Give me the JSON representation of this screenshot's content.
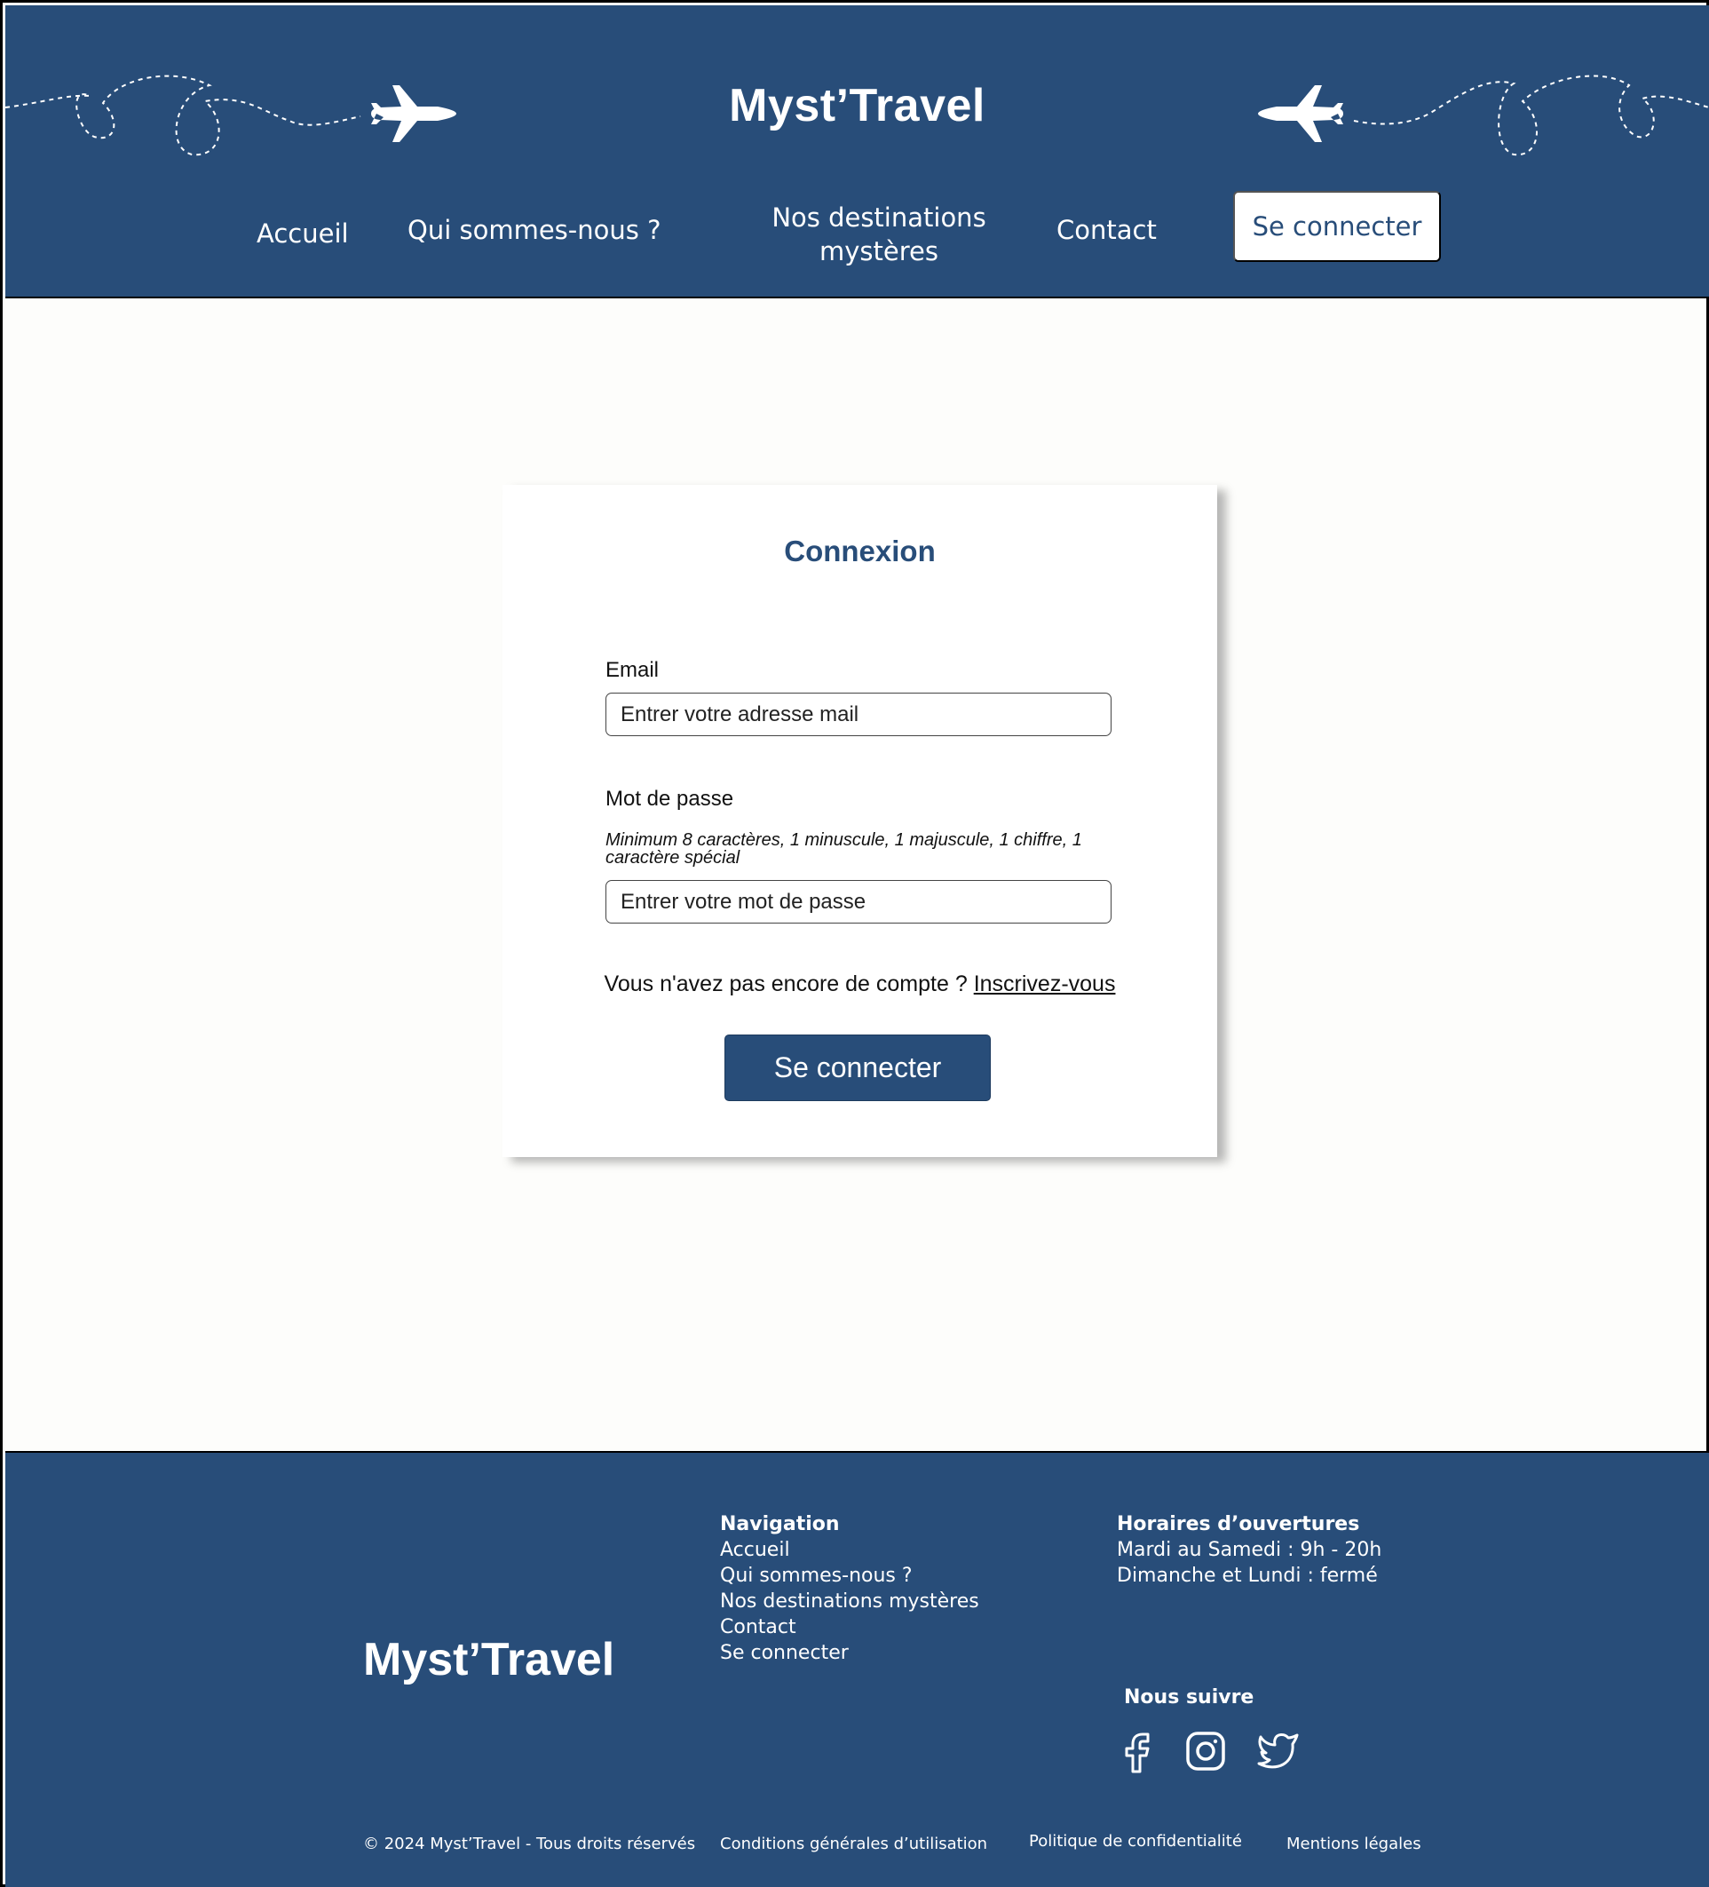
{
  "brand": {
    "name": "Myst’Travel",
    "primary_color": "#284d79"
  },
  "header": {
    "nav": {
      "accueil": "Accueil",
      "qui": "Qui sommes-nous ?",
      "destinations_line1": "Nos destinations",
      "destinations_line2": "mystères",
      "contact": "Contact",
      "login_button": "Se connecter"
    },
    "decorations": [
      "airplane-icon",
      "dashed-flight-path"
    ]
  },
  "login": {
    "title": "Connexion",
    "email_label": "Email",
    "email_placeholder": "Entrer votre adresse mail",
    "password_label": "Mot de passe",
    "password_hint": "Minimum 8 caractères, 1 minuscule, 1 majuscule, 1 chiffre, 1 caractère spécial",
    "password_placeholder": "Entrer votre mot de passe",
    "signup_text": "Vous n'avez pas encore de compte ? ",
    "signup_link": "Inscrivez-vous",
    "submit": "Se connecter"
  },
  "footer": {
    "logo": "Myst’Travel",
    "navigation": {
      "title": "Navigation",
      "items": [
        "Accueil",
        "Qui sommes-nous ?",
        "Nos destinations mystères",
        "Contact",
        "Se connecter"
      ]
    },
    "hours": {
      "title": "Horaires d’ouvertures",
      "lines": [
        "Mardi au Samedi : 9h - 20h",
        "Dimanche et Lundi : fermé"
      ]
    },
    "social": {
      "title": "Nous suivre",
      "icons": [
        "facebook-icon",
        "instagram-icon",
        "twitter-icon"
      ]
    },
    "legal": {
      "copyright": "© 2024 Myst’Travel - Tous droits réservés",
      "cgu": "Conditions générales d’utilisation",
      "privacy": "Politique de confidentialité",
      "mentions": "Mentions légales"
    }
  }
}
